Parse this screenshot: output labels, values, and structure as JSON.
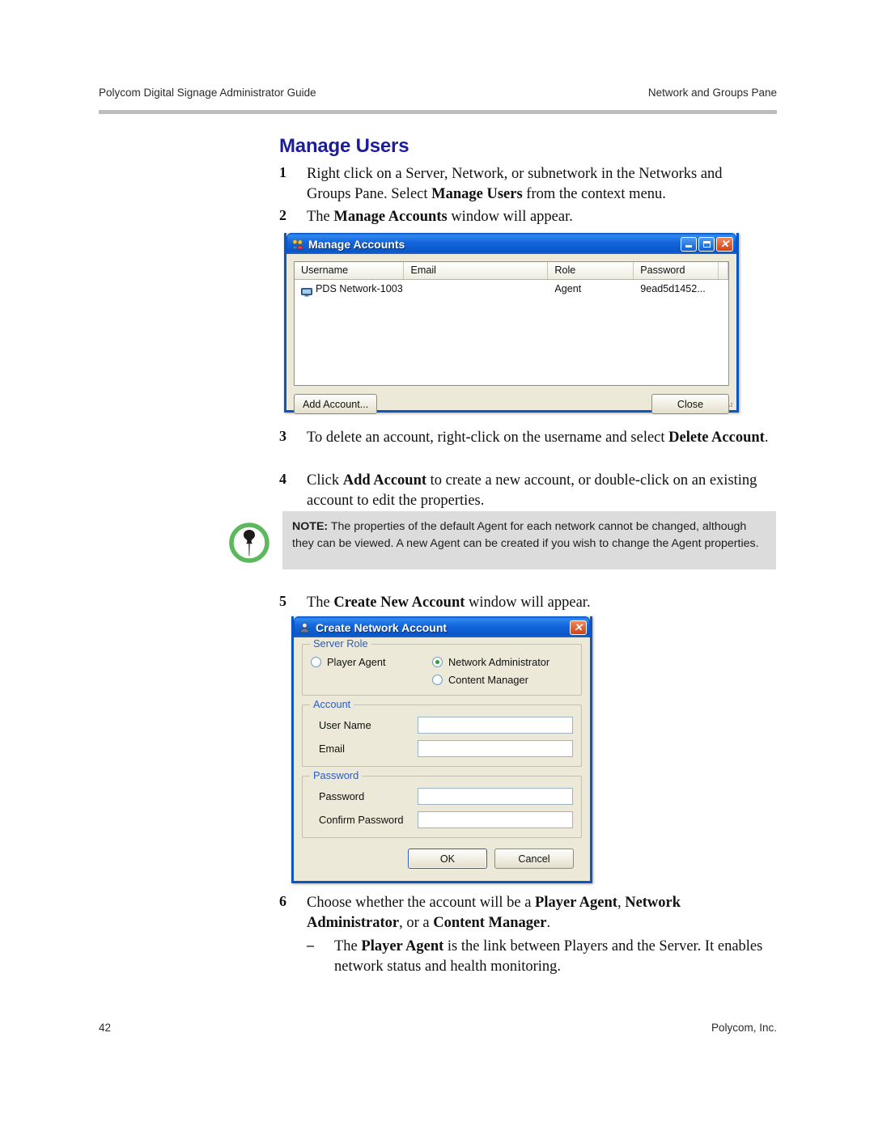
{
  "header": {
    "left": "Polycom Digital Signage Administrator Guide",
    "right": "Network and Groups Pane"
  },
  "footer": {
    "page_number": "42",
    "company": "Polycom, Inc."
  },
  "section": {
    "title": "Manage Users",
    "title_color": "#1d1d9c"
  },
  "steps": [
    {
      "number": "1",
      "parts": [
        {
          "t": "Right click on a Server, Network, or subnetwork in the Networks and Groups Pane. Select ",
          "b": false
        },
        {
          "t": "Manage Users",
          "b": true
        },
        {
          "t": " from the context menu.",
          "b": false
        }
      ]
    },
    {
      "number": "2",
      "parts": [
        {
          "t": "The ",
          "b": false
        },
        {
          "t": "Manage Accounts",
          "b": true
        },
        {
          "t": " window will appear.",
          "b": false
        }
      ]
    },
    {
      "number": "3",
      "parts": [
        {
          "t": "To delete an account, right-click on the username and select ",
          "b": false
        },
        {
          "t": "Delete Account",
          "b": true
        },
        {
          "t": ".",
          "b": false
        }
      ]
    },
    {
      "number": "4",
      "parts": [
        {
          "t": "Click ",
          "b": false
        },
        {
          "t": "Add Account",
          "b": true
        },
        {
          "t": " to create a new account, or double-click on an existing account to edit the properties.",
          "b": false
        }
      ]
    },
    {
      "number": "5",
      "parts": [
        {
          "t": "The ",
          "b": false
        },
        {
          "t": "Create New Account",
          "b": true
        },
        {
          "t": " window will appear.",
          "b": false
        }
      ]
    },
    {
      "number": "6",
      "parts": [
        {
          "t": "Choose whether the account will be a ",
          "b": false
        },
        {
          "t": "Player Agent",
          "b": true
        },
        {
          "t": ", ",
          "b": false
        },
        {
          "t": "Network Administrator",
          "b": true
        },
        {
          "t": ", or a ",
          "b": false
        },
        {
          "t": "Content Manager",
          "b": true
        },
        {
          "t": ".",
          "b": false
        }
      ]
    }
  ],
  "sub_bullet": {
    "dash": "–",
    "parts": [
      {
        "t": "The ",
        "b": false
      },
      {
        "t": "Player Agent",
        "b": true
      },
      {
        "t": " is the link between Players and the Server. It enables network status and health monitoring.",
        "b": false
      }
    ]
  },
  "note": {
    "icon": "note-pin-icon",
    "icon_ring_color": "#5cb85c",
    "background": "#dcdcdc",
    "label": "NOTE:",
    "text": " The properties of the default Agent for each network cannot be changed, although they can be viewed. A new Agent can be created if you wish to change the Agent properties."
  },
  "manage_accounts_window": {
    "title": "Manage Accounts",
    "title_icon": "users-icon",
    "titlebar_color": "#0b55c4",
    "buttons": {
      "minimize": "minimize-icon",
      "maximize": "maximize-icon",
      "close": "close-icon"
    },
    "columns": [
      "Username",
      "Email",
      "Role",
      "Password"
    ],
    "rows": [
      {
        "icon": "monitor-icon",
        "username": "PDS Network-1003...",
        "email": "",
        "role": "Agent",
        "password": "9ead5d1452..."
      }
    ],
    "add_account_label": "Add Account...",
    "close_label": "Close"
  },
  "create_account_window": {
    "title": "Create Network Account",
    "title_icon": "user-icon",
    "close_button": "close-icon",
    "groups": {
      "server_role": {
        "label": "Server Role",
        "options": [
          {
            "label": "Player Agent",
            "selected": false
          },
          {
            "label": "Network Administrator",
            "selected": true
          },
          {
            "label": "Content Manager",
            "selected": false
          }
        ]
      },
      "account": {
        "label": "Account",
        "fields": [
          {
            "label": "User Name",
            "value": ""
          },
          {
            "label": "Email",
            "value": ""
          }
        ]
      },
      "password": {
        "label": "Password",
        "fields": [
          {
            "label": "Password",
            "value": ""
          },
          {
            "label": "Confirm Password",
            "value": ""
          }
        ]
      }
    },
    "ok_label": "OK",
    "cancel_label": "Cancel"
  }
}
